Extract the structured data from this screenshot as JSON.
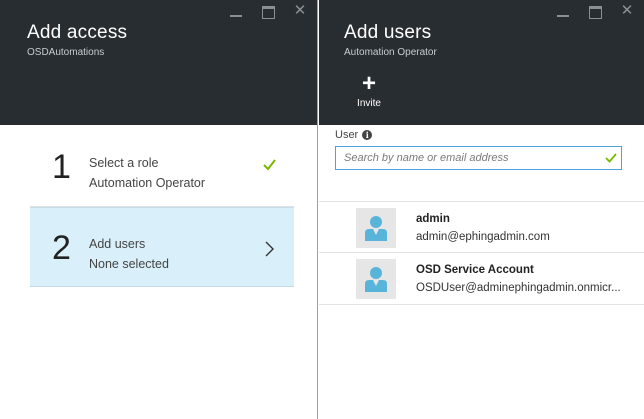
{
  "left_blade": {
    "title": "Add access",
    "subtitle": "OSDAutomations",
    "steps": [
      {
        "number": "1",
        "title": "Select a role",
        "value": "Automation Operator",
        "status_icon": "check-icon"
      },
      {
        "number": "2",
        "title": "Add users",
        "value": "None selected",
        "status_icon": "chevron-right-icon"
      }
    ]
  },
  "right_blade": {
    "title": "Add users",
    "subtitle": "Automation Operator",
    "invite_label": "Invite",
    "user_field_label": "User",
    "search": {
      "placeholder": "Search by name or email address",
      "value": ""
    },
    "users": [
      {
        "name": "admin",
        "email": "admin@ephingadmin.com"
      },
      {
        "name": "OSD Service Account",
        "email": "OSDUser@adminephingadmin.onmicr..."
      }
    ]
  },
  "colors": {
    "header_bg": "#282d32",
    "selected_step_bg": "#d9f0fa",
    "check_green": "#7ab800",
    "avatar_blue": "#59b4d9",
    "search_border": "#4aa3df"
  }
}
